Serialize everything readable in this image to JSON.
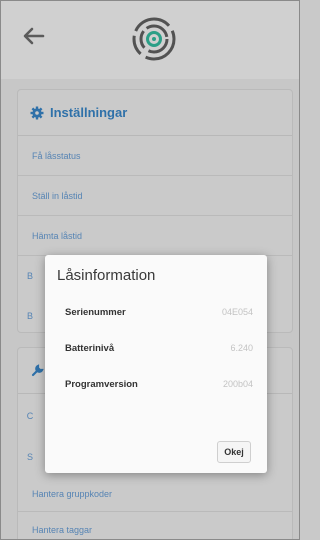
{
  "header": {
    "back_icon": "arrow-left-icon",
    "logo_icon": "fingerprint-logo-icon"
  },
  "settings": {
    "title": "Inställningar",
    "icon": "gear-icon",
    "items": [
      {
        "label": "Få låsstatus"
      },
      {
        "label": "Ställ in låstid"
      },
      {
        "label": "Hämta låstid"
      },
      {
        "label": "B"
      },
      {
        "label": "B"
      }
    ]
  },
  "second_card": {
    "icon": "wrench-icon",
    "items": [
      {
        "label": "C"
      },
      {
        "label": "S"
      },
      {
        "label": "Hantera gruppkoder"
      },
      {
        "label": "Hantera taggar"
      }
    ]
  },
  "dialog": {
    "title": "Låsinformation",
    "rows": [
      {
        "label": "Serienummer",
        "value": "04E054"
      },
      {
        "label": "Batterinivå",
        "value": "6.240"
      },
      {
        "label": "Programversion",
        "value": "200b04"
      }
    ],
    "ok_label": "Okej"
  }
}
